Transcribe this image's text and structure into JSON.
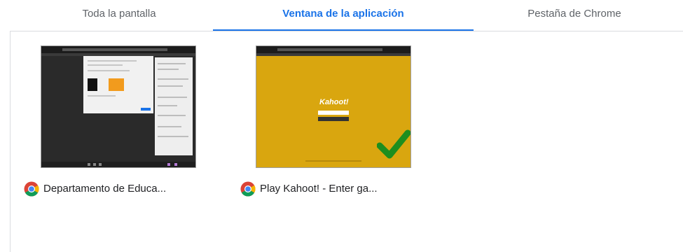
{
  "tabs": [
    {
      "label": "Toda la pantalla",
      "active": false
    },
    {
      "label": "Ventana de la aplicación",
      "active": true
    },
    {
      "label": "Pestaña de Chrome",
      "active": false
    }
  ],
  "windows": [
    {
      "title": "Departamento de Educa...",
      "icon": "chrome-icon",
      "selected": false
    },
    {
      "title": "Play Kahoot! - Enter ga...",
      "icon": "chrome-icon",
      "selected": true
    }
  ],
  "kahoot_logo": "Kahoot!",
  "colors": {
    "accent": "#1a73e8",
    "kahoot_bg": "#d9a60f",
    "check": "#1e8e1e"
  }
}
